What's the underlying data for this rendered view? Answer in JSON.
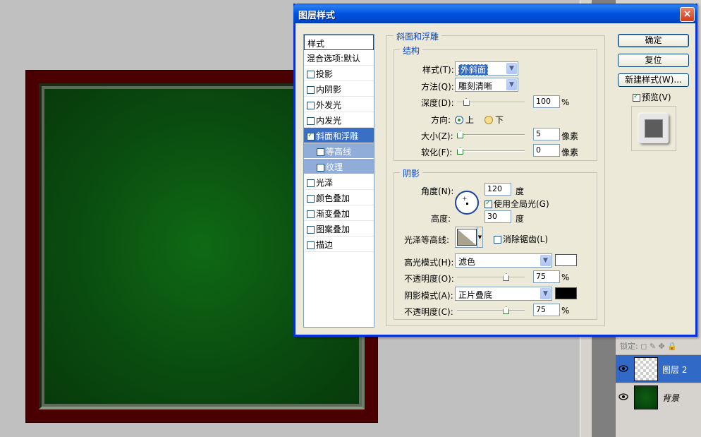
{
  "dialog": {
    "title": "图层样式",
    "style_list": {
      "header": "样式",
      "blend_options": "混合选项:默认",
      "items": [
        {
          "label": "投影",
          "checked": false
        },
        {
          "label": "内阴影",
          "checked": false
        },
        {
          "label": "外发光",
          "checked": false
        },
        {
          "label": "内发光",
          "checked": false
        },
        {
          "label": "斜面和浮雕",
          "checked": true,
          "selected": true
        },
        {
          "label": "等高线",
          "checked": false,
          "sub": true
        },
        {
          "label": "纹理",
          "checked": false,
          "sub": true
        },
        {
          "label": "光泽",
          "checked": false
        },
        {
          "label": "颜色叠加",
          "checked": false
        },
        {
          "label": "渐变叠加",
          "checked": false
        },
        {
          "label": "图案叠加",
          "checked": false
        },
        {
          "label": "描边",
          "checked": false
        }
      ]
    },
    "bevel": {
      "title": "斜面和浮雕",
      "structure": {
        "title": "结构",
        "style_label": "样式(T):",
        "style_value": "外斜面",
        "technique_label": "方法(Q):",
        "technique_value": "雕刻清晰",
        "depth_label": "深度(D):",
        "depth_value": "100",
        "depth_unit": "%",
        "depth_level": 0.1,
        "direction_label": "方向:",
        "direction_up": "上",
        "direction_down": "下",
        "size_label": "大小(Z):",
        "size_value": "5",
        "size_unit": "像素",
        "size_level": 0.0,
        "soften_label": "软化(F):",
        "soften_value": "0",
        "soften_unit": "像素",
        "soften_level": 0.0
      },
      "shading": {
        "title": "阴影",
        "angle_label": "角度(N):",
        "angle_value": "120",
        "angle_unit": "度",
        "global_light_label": "使用全局光(G)",
        "global_light_checked": true,
        "altitude_label": "高度:",
        "altitude_value": "30",
        "altitude_unit": "度",
        "gloss_contour_label": "光泽等高线:",
        "anti_alias_label": "消除锯齿(L)",
        "anti_alias_checked": false,
        "highlight_mode_label": "高光模式(H):",
        "highlight_mode_value": "滤色",
        "highlight_color": "#ffffff",
        "highlight_opacity_label": "不透明度(O):",
        "highlight_opacity_value": "75",
        "highlight_opacity_level": 0.75,
        "shadow_mode_label": "阴影模式(A):",
        "shadow_mode_value": "正片叠底",
        "shadow_color": "#000000",
        "shadow_opacity_label": "不透明度(C):",
        "shadow_opacity_value": "75",
        "shadow_opacity_level": 0.75,
        "percent_unit": "%"
      }
    },
    "buttons": {
      "ok": "确定",
      "reset": "复位",
      "new_style": "新建样式(W)...",
      "preview_label": "预览(V)",
      "preview_checked": true
    },
    "close_icon": "×"
  },
  "layers_panel": {
    "lock_label": "锁定:",
    "lock_icons": "◻ ✎ ✥ 🔒",
    "layers": [
      {
        "name": "图层 2",
        "selected": true,
        "thumb": "checker"
      },
      {
        "name": "背景",
        "selected": false,
        "thumb": "green"
      }
    ]
  },
  "colors": {
    "canvas_frame": "#4a0000",
    "canvas_fill": "#0a4d10",
    "accent": "#0831d9"
  }
}
